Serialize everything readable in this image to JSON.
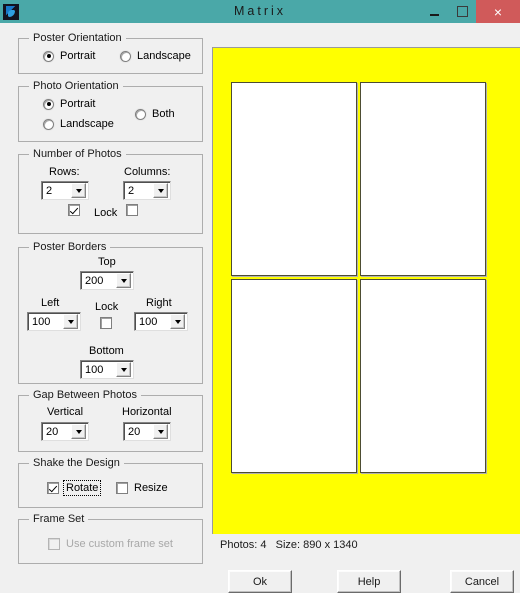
{
  "window": {
    "title": "Matrix",
    "icon": "app-icon",
    "controls": {
      "minimize": "–",
      "maximize": "□",
      "close": "×"
    },
    "colors": {
      "titlebar": "#4aa8a8",
      "close_button": "#d05a5a",
      "dialog_background": "#f0f0f0",
      "poster": "#ffff00",
      "photo": "#ffffff"
    }
  },
  "poster_orientation": {
    "legend": "Poster Orientation",
    "options": [
      {
        "label": "Portrait",
        "selected": true
      },
      {
        "label": "Landscape",
        "selected": false
      }
    ]
  },
  "photo_orientation": {
    "legend": "Photo Orientation",
    "options": [
      {
        "label": "Portrait",
        "selected": true
      },
      {
        "label": "Landscape",
        "selected": false
      },
      {
        "label": "Both",
        "selected": false
      }
    ]
  },
  "number_of_photos": {
    "legend": "Number of Photos",
    "rows_label": "Rows:",
    "rows_value": "2",
    "columns_label": "Columns:",
    "columns_value": "2",
    "lock_label": "Lock",
    "lock_left_checked": true,
    "lock_right_checked": false
  },
  "poster_borders": {
    "legend": "Poster Borders",
    "top_label": "Top",
    "top_value": "200",
    "left_label": "Left",
    "left_value": "100",
    "right_label": "Right",
    "right_value": "100",
    "bottom_label": "Bottom",
    "bottom_value": "100",
    "lock_label": "Lock",
    "lock_checked": false
  },
  "gap_between_photos": {
    "legend": "Gap Between Photos",
    "vertical_label": "Vertical",
    "vertical_value": "20",
    "horizontal_label": "Horizontal",
    "horizontal_value": "20"
  },
  "shake_the_design": {
    "legend": "Shake the Design",
    "rotate_label": "Rotate",
    "rotate_checked": true,
    "resize_label": "Resize",
    "resize_checked": false
  },
  "frame_set": {
    "legend": "Frame Set",
    "custom_label": "Use custom frame set",
    "custom_checked": false,
    "disabled": true
  },
  "preview": {
    "rows": 2,
    "columns": 2,
    "photo_count": 4
  },
  "status": {
    "text": "Photos: 4   Size: 890 x 1340",
    "photos": "4",
    "size": "890 x 1340"
  },
  "buttons": {
    "ok": "Ok",
    "help": "Help",
    "cancel": "Cancel"
  }
}
